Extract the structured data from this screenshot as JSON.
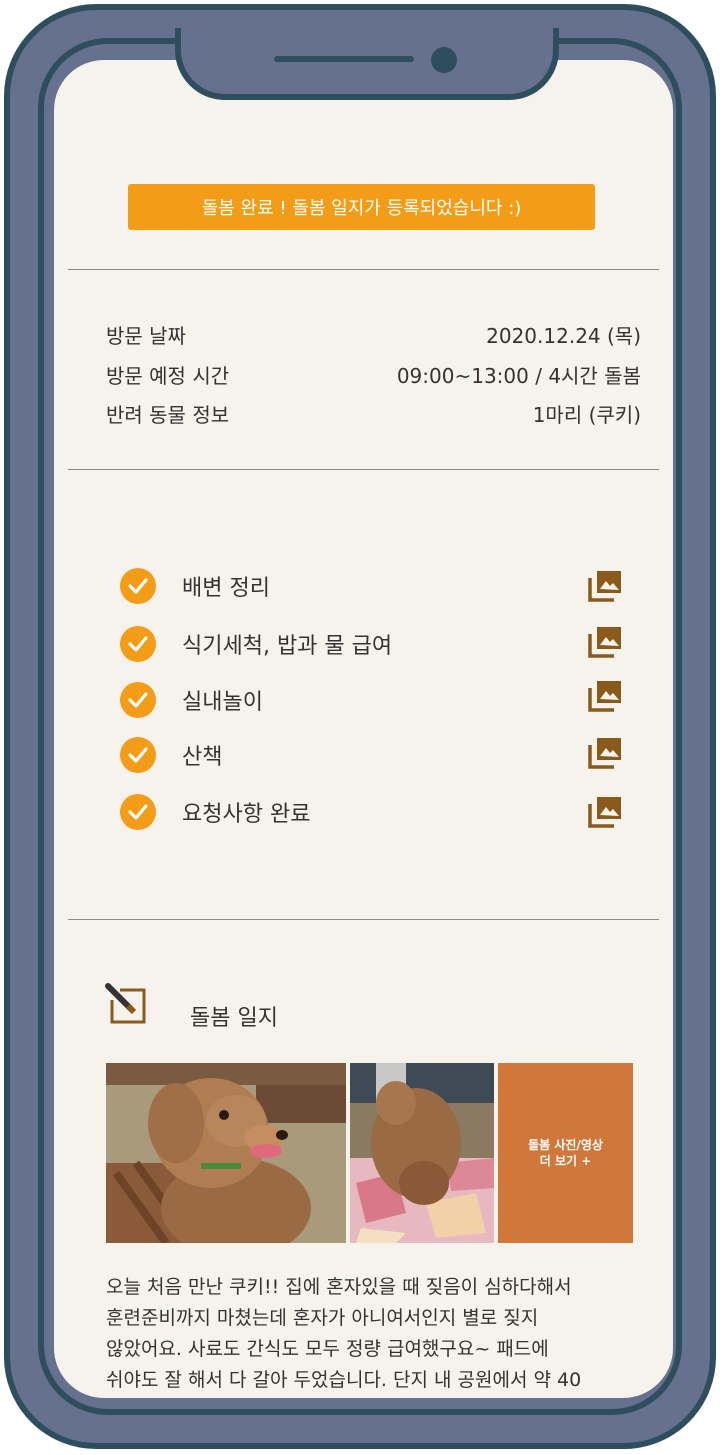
{
  "banner": {
    "text": "돌봄 완료 ! 돌봄 일지가 등록되었습니다 :)"
  },
  "visit_info": [
    {
      "label": "방문 날짜",
      "value": "2020.12.24 (목)"
    },
    {
      "label": "방문 예정 시간",
      "value": "09:00~13:00  / 4시간 돌봄"
    },
    {
      "label": "반려 동물 정보",
      "value": "1마리 (쿠키)"
    }
  ],
  "tasks": [
    {
      "label": "배변 정리"
    },
    {
      "label": "식기세척, 밥과 물 급여"
    },
    {
      "label": "실내놀이"
    },
    {
      "label": "산책"
    },
    {
      "label": "요청사항 완료"
    }
  ],
  "diary": {
    "title": "돌봄 일지",
    "more_line1": "돌봄 사진/영상",
    "more_line2": "더 보기 +",
    "text": "오늘 처음 만난 쿠키!! 집에 혼자있을 때 짖음이 심하다해서\n훈련준비까지 마쳤는데 혼자가 아니여서인지 별로 짖지\n않았어요. 사료도 간식도 모두 정량 급여했구요~   패드에\n쉬야도 잘 해서 다 갈아 두었습니다.  단지 내 공원에서 약 40"
  },
  "colors": {
    "accent": "#f39c17",
    "icon_brown": "#8a5a1c",
    "more_box": "#d0783c",
    "screen_bg": "#f6f3ec"
  }
}
